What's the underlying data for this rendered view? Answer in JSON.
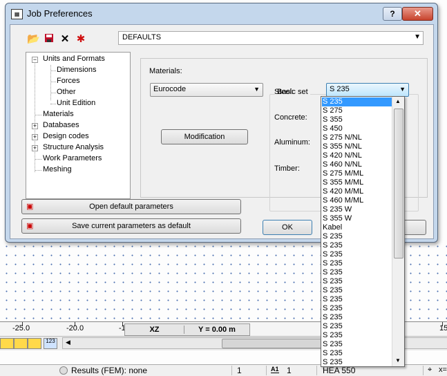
{
  "dialog": {
    "title": "Job Preferences",
    "help_label": "?",
    "close_label": "✕",
    "preset_value": "DEFAULTS"
  },
  "tree": {
    "items": [
      {
        "label": "Units and Formats",
        "expander": "−"
      },
      {
        "label": "Dimensions"
      },
      {
        "label": "Forces"
      },
      {
        "label": "Other"
      },
      {
        "label": "Unit Edition"
      },
      {
        "label": "Materials"
      },
      {
        "label": "Databases",
        "expander": "+"
      },
      {
        "label": "Design codes",
        "expander": "+"
      },
      {
        "label": "Structure Analysis",
        "expander": "+"
      },
      {
        "label": "Work Parameters"
      },
      {
        "label": "Meshing"
      }
    ]
  },
  "materials": {
    "materials_label": "Materials:",
    "materials_value": "Eurocode",
    "modification_label": "Modification",
    "basic_set_label": "Basic set",
    "steel_label": "Steel:",
    "steel_value": "S 235",
    "concrete_label": "Concrete:",
    "aluminum_label": "Aluminum:",
    "timber_label": "Timber:"
  },
  "buttons": {
    "open_default": "Open default parameters",
    "save_default": "Save current parameters as default",
    "ok": "OK"
  },
  "dropdown": {
    "options": [
      "S 235",
      "S 275",
      "S 355",
      "S 450",
      "S 275 N/NL",
      "S 355  N/NL",
      "S 420  N/NL",
      "S 460  N/NL",
      "S 275 M/ML",
      "S 355  M/ML",
      "S 420  M/ML",
      "S 460  M/ML",
      "S 235 W",
      "S 355 W",
      "Kabel",
      "S 235",
      "S 235",
      "S 235",
      "S 235",
      "S 235",
      "S 235",
      "S 235",
      "S 235",
      "S 235",
      "S 235",
      "S 235",
      "S 235",
      "S 235",
      "S 235",
      "S 235"
    ],
    "selected_index": 0
  },
  "background": {
    "ruler_labels": [
      "-25.0",
      "-20.0",
      "-1",
      "15"
    ],
    "view_label": "XZ",
    "coord_label": "Y = 0.00 m",
    "toolbar_button_label": "123",
    "status": {
      "results": "Results (FEM): none",
      "num1": "1",
      "a1_label": "A1",
      "num2": "1",
      "section": "HEA 550",
      "x_label": "x="
    }
  },
  "colors": {
    "selection": "#3399ff",
    "title_bar": "#c4d7ec",
    "close_button": "#c7432d"
  }
}
